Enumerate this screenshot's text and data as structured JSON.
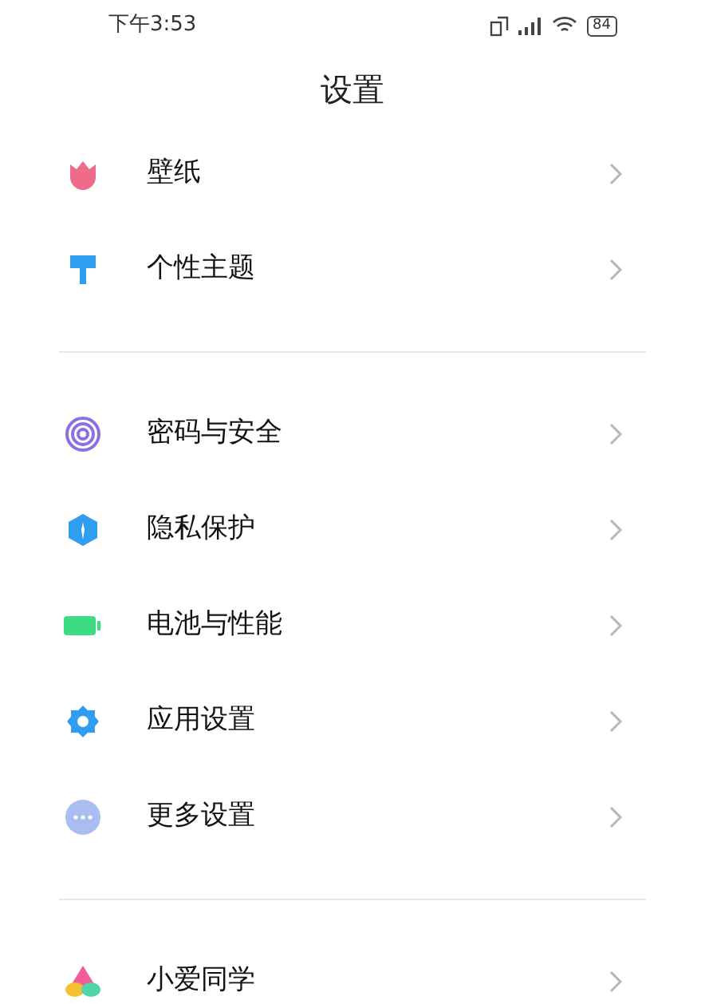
{
  "status_bar": {
    "time": "下午3:53",
    "battery": "84"
  },
  "title": "设置",
  "sections": [
    {
      "items": [
        {
          "label": "壁纸"
        },
        {
          "label": "个性主题"
        }
      ]
    },
    {
      "items": [
        {
          "label": "密码与安全"
        },
        {
          "label": "隐私保护"
        },
        {
          "label": "电池与性能"
        },
        {
          "label": "应用设置"
        },
        {
          "label": "更多设置"
        }
      ]
    },
    {
      "items": [
        {
          "label": "小爱同学"
        }
      ]
    }
  ]
}
